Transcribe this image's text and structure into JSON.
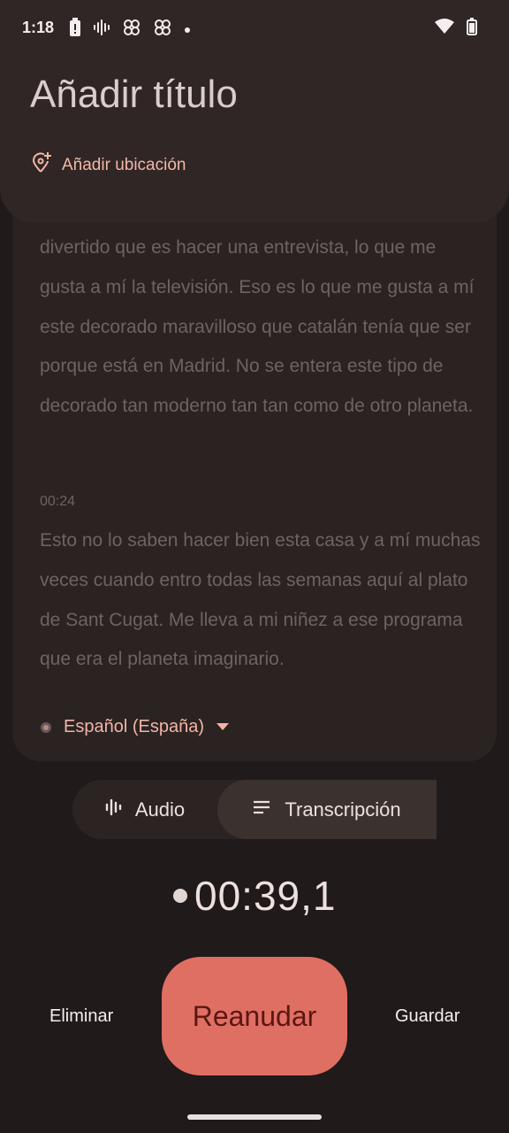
{
  "status_bar": {
    "time": "1:18"
  },
  "header": {
    "title": "Añadir título",
    "location_label": "Añadir ubicación"
  },
  "transcript": {
    "paragraph_1": "divertido que es hacer una entrevista, lo que me gusta a mí la televisión. Eso es lo que me gusta a mí este decorado maravilloso que catalán tenía que ser porque está en Madrid. No se entera este tipo de decorado tan moderno tan tan como de otro planeta.",
    "timestamp": "00:24",
    "paragraph_2": "Esto no lo saben hacer bien esta casa y a mí muchas veces cuando entro todas las semanas aquí al plato de Sant Cugat. Me lleva a mi niñez a ese programa que era el planeta imaginario.",
    "language": "Español (España)"
  },
  "tabs": {
    "audio": "Audio",
    "transcription": "Transcripción"
  },
  "timer": "00:39,1",
  "actions": {
    "delete": "Eliminar",
    "resume": "Reanudar",
    "save": "Guardar"
  },
  "colors": {
    "accent": "#e06f63",
    "accent_text": "#f5b6a6",
    "background": "#201a1a"
  }
}
